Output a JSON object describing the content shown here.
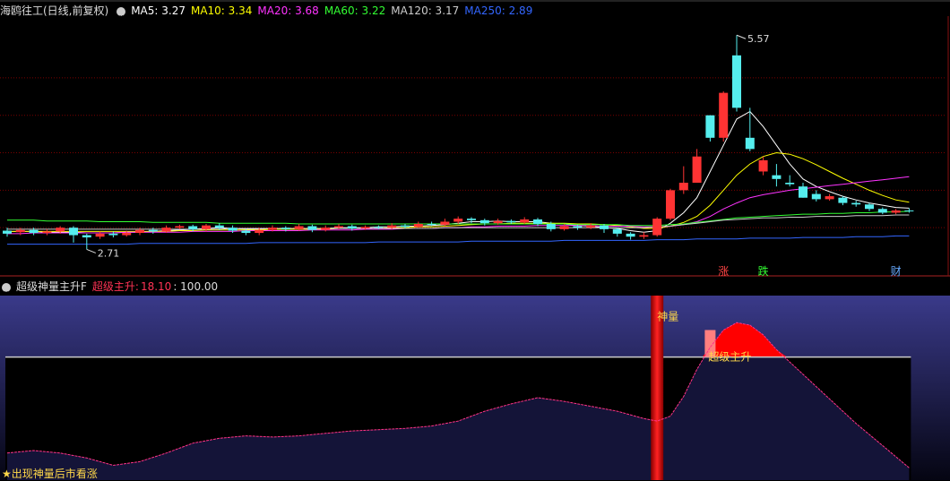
{
  "main_header": {
    "title": "海鸥往工(日线,前复权)",
    "ma": [
      {
        "label": "MA5:",
        "value": "3.27",
        "color": "#ffffff"
      },
      {
        "label": "MA10:",
        "value": "3.34",
        "color": "#ffff00"
      },
      {
        "label": "MA20:",
        "value": "3.68",
        "color": "#ff33ff"
      },
      {
        "label": "MA60:",
        "value": "3.22",
        "color": "#33ff33"
      },
      {
        "label": "MA120:",
        "value": "3.17",
        "color": "#cccccc"
      },
      {
        "label": "MA250:",
        "value": "2.89",
        "color": "#3366ff"
      }
    ]
  },
  "sub_header": {
    "title": "超级神量主升F",
    "indicator_label": "超级主升:",
    "indicator_value": "18.10",
    "extra_value": ": 100.00"
  },
  "footer_note": "★出现神量后市看涨",
  "colors": {
    "up": "#ff3333",
    "down": "#55eeee",
    "grid": "#7a0000",
    "signal_zhang": "#ff4444",
    "signal_die": "#33ff33",
    "signal_cai": "#66aaff"
  },
  "chart_data": [
    {
      "type": "candlestick",
      "price_range": [
        2.5,
        5.8
      ],
      "high_label": "5.57",
      "low_label": "2.71",
      "signals": [
        {
          "label": "涨",
          "index": 54
        },
        {
          "label": "跌",
          "index": 57
        },
        {
          "label": "财",
          "index": 67
        }
      ],
      "candles": [
        [
          2.96,
          2.92,
          3.0,
          2.88
        ],
        [
          2.94,
          2.97,
          3.0,
          2.9
        ],
        [
          2.97,
          2.93,
          3.0,
          2.9
        ],
        [
          2.93,
          2.95,
          2.98,
          2.9
        ],
        [
          2.95,
          3.0,
          3.02,
          2.92
        ],
        [
          3.0,
          2.9,
          3.02,
          2.8
        ],
        [
          2.9,
          2.87,
          2.92,
          2.71
        ],
        [
          2.88,
          2.92,
          2.95,
          2.85
        ],
        [
          2.92,
          2.9,
          2.95,
          2.87
        ],
        [
          2.9,
          2.93,
          2.96,
          2.88
        ],
        [
          2.93,
          2.97,
          3.0,
          2.9
        ],
        [
          2.97,
          2.95,
          3.0,
          2.92
        ],
        [
          2.95,
          3.0,
          3.03,
          2.93
        ],
        [
          3.0,
          3.02,
          3.04,
          2.98
        ],
        [
          3.02,
          2.98,
          3.04,
          2.95
        ],
        [
          2.98,
          3.03,
          3.05,
          2.95
        ],
        [
          3.03,
          3.0,
          3.06,
          2.97
        ],
        [
          3.0,
          2.96,
          3.03,
          2.93
        ],
        [
          2.96,
          2.93,
          2.98,
          2.9
        ],
        [
          2.93,
          2.97,
          3.0,
          2.9
        ],
        [
          2.97,
          3.0,
          3.03,
          2.95
        ],
        [
          3.0,
          2.98,
          3.02,
          2.95
        ],
        [
          2.98,
          3.02,
          3.05,
          2.96
        ],
        [
          3.02,
          2.97,
          3.04,
          2.94
        ],
        [
          2.97,
          3.0,
          3.03,
          2.95
        ],
        [
          3.0,
          3.02,
          3.05,
          2.98
        ],
        [
          3.02,
          2.99,
          3.04,
          2.96
        ],
        [
          2.99,
          3.01,
          3.03,
          2.97
        ],
        [
          3.01,
          3.0,
          3.03,
          2.98
        ],
        [
          3.0,
          3.03,
          3.06,
          2.98
        ],
        [
          3.03,
          3.01,
          3.05,
          2.99
        ],
        [
          3.01,
          3.05,
          3.08,
          3.0
        ],
        [
          3.05,
          3.04,
          3.08,
          3.02
        ],
        [
          3.04,
          3.08,
          3.12,
          3.02
        ],
        [
          3.08,
          3.12,
          3.15,
          3.05
        ],
        [
          3.12,
          3.1,
          3.14,
          3.06
        ],
        [
          3.1,
          3.06,
          3.12,
          3.03
        ],
        [
          3.06,
          3.09,
          3.12,
          3.04
        ],
        [
          3.09,
          3.07,
          3.11,
          3.05
        ],
        [
          3.07,
          3.11,
          3.14,
          3.05
        ],
        [
          3.11,
          3.05,
          3.13,
          3.02
        ],
        [
          3.05,
          2.98,
          3.08,
          2.95
        ],
        [
          2.98,
          3.02,
          3.05,
          2.96
        ],
        [
          3.02,
          3.0,
          3.04,
          2.97
        ],
        [
          3.0,
          3.03,
          3.06,
          2.98
        ],
        [
          3.03,
          2.98,
          3.05,
          2.93
        ],
        [
          2.98,
          2.92,
          3.0,
          2.88
        ],
        [
          2.92,
          2.88,
          2.94,
          2.84
        ],
        [
          2.88,
          2.9,
          2.94,
          2.85
        ],
        [
          2.9,
          3.12,
          3.14,
          2.88
        ],
        [
          3.12,
          3.5,
          3.52,
          3.1
        ],
        [
          3.5,
          3.6,
          3.82,
          3.45
        ],
        [
          3.6,
          3.95,
          4.05,
          3.6
        ],
        [
          4.5,
          4.2,
          4.5,
          4.15
        ],
        [
          4.2,
          4.8,
          4.82,
          4.15
        ],
        [
          5.3,
          4.6,
          5.57,
          4.55
        ],
        [
          4.2,
          4.05,
          4.6,
          4.02
        ],
        [
          3.75,
          3.9,
          3.95,
          3.7
        ],
        [
          3.7,
          3.65,
          3.85,
          3.55
        ],
        [
          3.6,
          3.58,
          3.7,
          3.55
        ],
        [
          3.55,
          3.4,
          3.6,
          3.4
        ],
        [
          3.45,
          3.38,
          3.5,
          3.35
        ],
        [
          3.38,
          3.42,
          3.45,
          3.36
        ],
        [
          3.4,
          3.33,
          3.42,
          3.3
        ],
        [
          3.33,
          3.31,
          3.36,
          3.28
        ],
        [
          3.31,
          3.25,
          3.33,
          3.22
        ],
        [
          3.25,
          3.2,
          3.27,
          3.18
        ],
        [
          3.2,
          3.23,
          3.25,
          3.18
        ],
        [
          3.23,
          3.22,
          3.26,
          3.2
        ]
      ],
      "ma_lines": [
        {
          "name": "MA5",
          "color": "#ffffff",
          "values": [
            2.95,
            2.95,
            2.95,
            2.94,
            2.94,
            2.94,
            2.93,
            2.93,
            2.93,
            2.94,
            2.94,
            2.95,
            2.96,
            2.97,
            2.98,
            2.99,
            3.0,
            2.99,
            2.98,
            2.98,
            2.98,
            2.98,
            2.98,
            2.99,
            2.99,
            3.0,
            3.0,
            3.0,
            3.01,
            3.01,
            3.02,
            3.02,
            3.03,
            3.04,
            3.06,
            3.08,
            3.08,
            3.09,
            3.08,
            3.08,
            3.08,
            3.06,
            3.05,
            3.03,
            3.02,
            3.0,
            2.99,
            2.96,
            2.94,
            2.96,
            3.06,
            3.2,
            3.4,
            3.75,
            4.1,
            4.45,
            4.55,
            4.35,
            4.1,
            3.85,
            3.65,
            3.55,
            3.48,
            3.42,
            3.37,
            3.33,
            3.3,
            3.27,
            3.26
          ]
        },
        {
          "name": "MA10",
          "color": "#ffff00",
          "values": [
            2.95,
            2.95,
            2.95,
            2.95,
            2.95,
            2.95,
            2.95,
            2.95,
            2.95,
            2.95,
            2.95,
            2.95,
            2.95,
            2.96,
            2.96,
            2.97,
            2.97,
            2.97,
            2.97,
            2.97,
            2.98,
            2.98,
            2.98,
            2.98,
            2.98,
            2.99,
            2.99,
            2.99,
            2.99,
            3.0,
            3.0,
            3.01,
            3.01,
            3.02,
            3.03,
            3.04,
            3.05,
            3.05,
            3.06,
            3.06,
            3.06,
            3.06,
            3.06,
            3.05,
            3.05,
            3.04,
            3.03,
            3.01,
            2.99,
            2.99,
            3.02,
            3.07,
            3.15,
            3.3,
            3.5,
            3.7,
            3.85,
            3.95,
            4.0,
            3.98,
            3.92,
            3.84,
            3.75,
            3.66,
            3.58,
            3.5,
            3.43,
            3.37,
            3.34
          ]
        },
        {
          "name": "MA20",
          "color": "#ff33ff",
          "values": [
            2.92,
            2.92,
            2.93,
            2.93,
            2.93,
            2.93,
            2.93,
            2.93,
            2.93,
            2.94,
            2.94,
            2.94,
            2.94,
            2.94,
            2.95,
            2.95,
            2.95,
            2.95,
            2.96,
            2.96,
            2.96,
            2.96,
            2.96,
            2.97,
            2.97,
            2.97,
            2.97,
            2.98,
            2.98,
            2.98,
            2.99,
            2.99,
            2.99,
            3.0,
            3.0,
            3.01,
            3.01,
            3.02,
            3.02,
            3.02,
            3.03,
            3.03,
            3.03,
            3.03,
            3.03,
            3.02,
            3.02,
            3.02,
            3.01,
            3.01,
            3.02,
            3.04,
            3.08,
            3.15,
            3.25,
            3.33,
            3.4,
            3.44,
            3.47,
            3.5,
            3.52,
            3.54,
            3.56,
            3.58,
            3.6,
            3.62,
            3.64,
            3.66,
            3.68
          ]
        },
        {
          "name": "MA60",
          "color": "#33ff33",
          "values": [
            3.1,
            3.1,
            3.1,
            3.09,
            3.09,
            3.09,
            3.09,
            3.08,
            3.08,
            3.08,
            3.08,
            3.07,
            3.07,
            3.07,
            3.07,
            3.07,
            3.06,
            3.06,
            3.06,
            3.06,
            3.06,
            3.06,
            3.05,
            3.05,
            3.05,
            3.05,
            3.05,
            3.05,
            3.05,
            3.05,
            3.05,
            3.05,
            3.05,
            3.05,
            3.05,
            3.05,
            3.05,
            3.05,
            3.05,
            3.05,
            3.05,
            3.05,
            3.05,
            3.04,
            3.04,
            3.04,
            3.04,
            3.03,
            3.03,
            3.03,
            3.04,
            3.05,
            3.07,
            3.09,
            3.11,
            3.13,
            3.14,
            3.15,
            3.16,
            3.17,
            3.18,
            3.18,
            3.19,
            3.19,
            3.2,
            3.2,
            3.21,
            3.21,
            3.22
          ]
        },
        {
          "name": "MA120",
          "color": "#cccccc",
          "values": [
            2.98,
            2.98,
            2.98,
            2.98,
            2.98,
            2.98,
            2.98,
            2.98,
            2.98,
            2.98,
            2.98,
            2.98,
            2.98,
            2.98,
            2.98,
            2.98,
            2.98,
            2.99,
            2.99,
            2.99,
            2.99,
            2.99,
            2.99,
            2.99,
            2.99,
            2.99,
            2.99,
            2.99,
            2.99,
            2.99,
            2.99,
            2.99,
            2.99,
            3.0,
            3.0,
            3.0,
            3.0,
            3.0,
            3.0,
            3.0,
            3.0,
            3.0,
            3.0,
            3.0,
            3.0,
            3.0,
            3.0,
            3.0,
            3.0,
            3.01,
            3.02,
            3.04,
            3.06,
            3.08,
            3.1,
            3.11,
            3.12,
            3.13,
            3.13,
            3.14,
            3.14,
            3.15,
            3.15,
            3.15,
            3.16,
            3.16,
            3.16,
            3.17,
            3.17
          ]
        },
        {
          "name": "MA250",
          "color": "#3366ff",
          "values": [
            2.78,
            2.78,
            2.78,
            2.78,
            2.78,
            2.78,
            2.78,
            2.78,
            2.78,
            2.78,
            2.79,
            2.79,
            2.79,
            2.79,
            2.79,
            2.79,
            2.79,
            2.79,
            2.79,
            2.8,
            2.8,
            2.8,
            2.8,
            2.8,
            2.8,
            2.8,
            2.8,
            2.8,
            2.81,
            2.81,
            2.81,
            2.81,
            2.81,
            2.81,
            2.81,
            2.82,
            2.82,
            2.82,
            2.82,
            2.82,
            2.82,
            2.82,
            2.83,
            2.83,
            2.83,
            2.83,
            2.83,
            2.83,
            2.83,
            2.84,
            2.84,
            2.84,
            2.85,
            2.85,
            2.85,
            2.85,
            2.86,
            2.86,
            2.86,
            2.86,
            2.87,
            2.87,
            2.87,
            2.87,
            2.88,
            2.88,
            2.88,
            2.89,
            2.89
          ]
        }
      ]
    },
    {
      "type": "area",
      "y_range": [
        0,
        150
      ],
      "threshold": 100,
      "labels": [
        {
          "text": "神量",
          "index": 49
        },
        {
          "text": "超级主升",
          "index": 53
        }
      ],
      "spike_index": 49,
      "bar_index": 53,
      "line": [
        {
          "x": 0,
          "y": 22
        },
        {
          "x": 2,
          "y": 24
        },
        {
          "x": 4,
          "y": 22
        },
        {
          "x": 6,
          "y": 18
        },
        {
          "x": 8,
          "y": 12
        },
        {
          "x": 10,
          "y": 15
        },
        {
          "x": 12,
          "y": 22
        },
        {
          "x": 14,
          "y": 30
        },
        {
          "x": 16,
          "y": 34
        },
        {
          "x": 18,
          "y": 36
        },
        {
          "x": 20,
          "y": 35
        },
        {
          "x": 22,
          "y": 36
        },
        {
          "x": 24,
          "y": 38
        },
        {
          "x": 26,
          "y": 40
        },
        {
          "x": 28,
          "y": 41
        },
        {
          "x": 30,
          "y": 42
        },
        {
          "x": 32,
          "y": 44
        },
        {
          "x": 34,
          "y": 48
        },
        {
          "x": 36,
          "y": 56
        },
        {
          "x": 38,
          "y": 62
        },
        {
          "x": 40,
          "y": 67
        },
        {
          "x": 42,
          "y": 64
        },
        {
          "x": 44,
          "y": 60
        },
        {
          "x": 46,
          "y": 56
        },
        {
          "x": 48,
          "y": 50
        },
        {
          "x": 49,
          "y": 48
        },
        {
          "x": 50,
          "y": 52
        },
        {
          "x": 51,
          "y": 68
        },
        {
          "x": 52,
          "y": 90
        },
        {
          "x": 53,
          "y": 108
        },
        {
          "x": 54,
          "y": 122
        },
        {
          "x": 55,
          "y": 128
        },
        {
          "x": 56,
          "y": 126
        },
        {
          "x": 57,
          "y": 118
        },
        {
          "x": 58,
          "y": 106
        },
        {
          "x": 59,
          "y": 96
        },
        {
          "x": 60,
          "y": 86
        },
        {
          "x": 62,
          "y": 66
        },
        {
          "x": 64,
          "y": 46
        },
        {
          "x": 66,
          "y": 28
        },
        {
          "x": 68,
          "y": 10
        }
      ]
    }
  ]
}
